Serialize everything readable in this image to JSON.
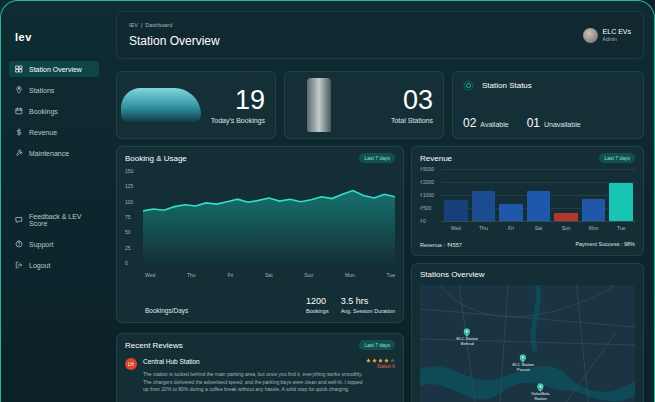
{
  "sidebar": {
    "logo": "lev",
    "items": [
      {
        "label": "Station Overview",
        "selected": true
      },
      {
        "label": "Stations",
        "selected": false
      },
      {
        "label": "Bookings",
        "selected": false
      },
      {
        "label": "Revenue",
        "selected": false
      },
      {
        "label": "Maintenance",
        "selected": false
      }
    ],
    "footer_items": [
      {
        "label": "Feedback & LEV Score",
        "selected": false
      },
      {
        "label": "Support",
        "selected": false
      },
      {
        "label": "Logout",
        "selected": false
      }
    ]
  },
  "header": {
    "breadcrumb": [
      "IEV",
      "|",
      "Dashboard"
    ],
    "title": "Station Overview",
    "user": {
      "name": "ELC EVs",
      "role": "Admin"
    }
  },
  "stats": {
    "bookings": {
      "value": "19",
      "label": "Today's Bookings"
    },
    "stations": {
      "value": "03",
      "label": "Total Stations"
    },
    "status": {
      "title": "Station Status",
      "items": [
        {
          "value": "02",
          "label": "Available"
        },
        {
          "value": "01",
          "label": "Unavailable"
        }
      ]
    }
  },
  "booking_chart": {
    "title": "Booking & Usage",
    "badge": "Last 7 days",
    "y_ticks": [
      "150",
      "125",
      "100",
      "75",
      "50",
      "25",
      "0"
    ],
    "x_labels": [
      "Wed",
      "Thu",
      "Fri",
      "Sat",
      "Sun",
      "Mon",
      "Tue"
    ],
    "values": [
      85,
      88,
      86,
      92,
      95,
      93,
      98,
      96,
      100,
      104,
      99,
      102,
      106,
      101,
      104,
      100,
      103,
      108,
      105,
      112,
      118,
      110,
      106,
      112,
      108
    ],
    "footer_label": "Bookings/Days",
    "metrics": [
      {
        "value": "1200",
        "label": "Bookings"
      },
      {
        "value": "3.5 hrs",
        "label": "Avg. Session Duration"
      }
    ]
  },
  "revenue_chart": {
    "title": "Revenue",
    "badge": "Last 7 days",
    "y_ticks": [
      "₹5000",
      "₹2000",
      "₹1000",
      "₹500",
      "₹0"
    ],
    "tick_values": [
      5000,
      2000,
      1000,
      500,
      0
    ],
    "bars": [
      {
        "label": "Wed",
        "value": 800,
        "color": "#17407a"
      },
      {
        "label": "Thu",
        "value": 1300,
        "color": "#1b4c92"
      },
      {
        "label": "Fri",
        "value": 650,
        "color": "#1f58aa"
      },
      {
        "label": "Sat",
        "value": 1300,
        "color": "#1f58aa"
      },
      {
        "label": "Sun",
        "value": 300,
        "color": "#b3372c"
      },
      {
        "label": "Mon",
        "value": 850,
        "color": "#1f58aa"
      },
      {
        "label": "Tue",
        "value": 1900,
        "color": "#18c4b2"
      }
    ],
    "revenue": "Revenue : ₹4557",
    "payment": "Payment Success : 98%"
  },
  "stations_map": {
    "title": "Stations Overview",
    "pins": [
      {
        "name": "ELC Station",
        "area": "Behrud"
      },
      {
        "name": "ELC Station",
        "area": "Parvati"
      },
      {
        "name": "ValueBeta",
        "area": "Station"
      }
    ]
  },
  "reviews": {
    "title": "Recent Reviews",
    "badge": "Last 7 days",
    "items": [
      {
        "initials": "LH",
        "station": "Central Hub Station",
        "stars": 4,
        "tag": "Station A",
        "text": "The station is tucked behind the main parking area, but once you find it, everything works smoothly. The chargers delivered the advertised speed, and the parking bays were clean and well-lit. I topped up from 20% to 80% during a coffee break without any hassle. A solid stop for quick charging."
      }
    ]
  }
}
